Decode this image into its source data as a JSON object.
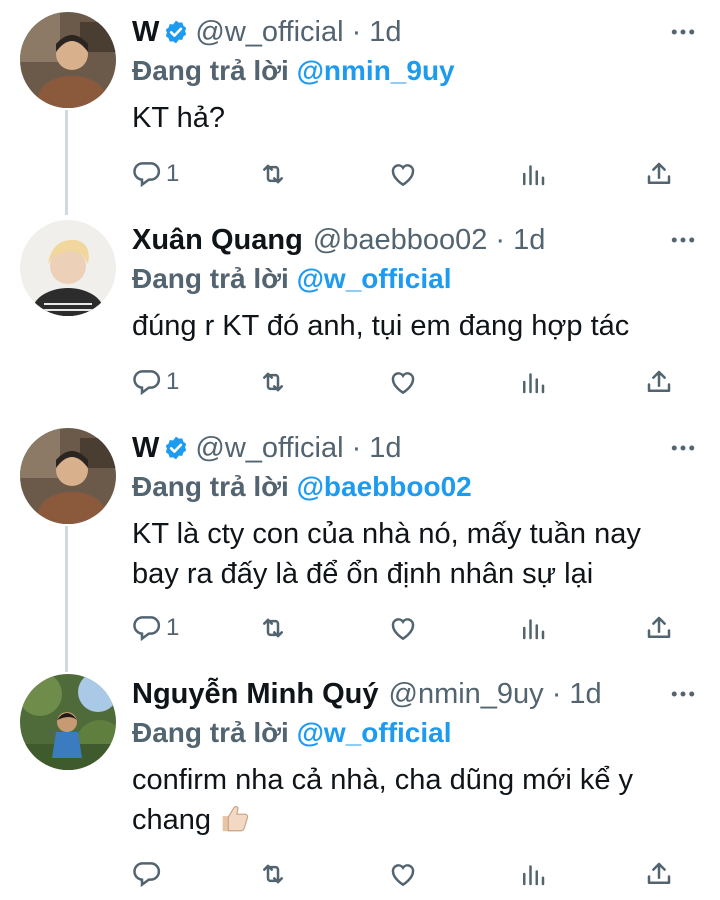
{
  "tweets": [
    {
      "name": "W",
      "verified": true,
      "handle": "@w_official",
      "dot": "·",
      "time": "1d",
      "replying_prefix": "Đang trả lời",
      "replying_to": "@nmin_9uy",
      "lines": [
        "KT hả?"
      ],
      "reply_count": "1",
      "avatar_colors": {
        "bg": "#6b5a4a",
        "skin": "#d9b08c",
        "hair": "#2b2420",
        "cloth": "#8b5a3c"
      }
    },
    {
      "name": "Xuân Quang",
      "verified": false,
      "handle": "@baebboo02",
      "dot": "·",
      "time": "1d",
      "replying_prefix": "Đang trả lời",
      "replying_to": "@w_official",
      "lines": [
        "đúng r KT đó anh, tụi em đang hợp tác"
      ],
      "reply_count": "1",
      "avatar_colors": {
        "bg": "#f1efec",
        "skin": "#ecd0b8",
        "hair": "#f2d79c",
        "cloth": "#2c2c2c"
      }
    },
    {
      "name": "W",
      "verified": true,
      "handle": "@w_official",
      "dot": "·",
      "time": "1d",
      "replying_prefix": "Đang trả lời",
      "replying_to": "@baebboo02",
      "lines": [
        "KT là cty con của nhà nó, mấy tuần nay",
        "bay ra đấy là để ổn định nhân sự lại"
      ],
      "reply_count": "1",
      "avatar_colors": {
        "bg": "#6b5a4a",
        "skin": "#d9b08c",
        "hair": "#2b2420",
        "cloth": "#8b5a3c"
      }
    },
    {
      "name": "Nguyễn Minh Quý",
      "verified": false,
      "handle": "@nmin_9uy",
      "dot": "·",
      "time": "1d",
      "replying_prefix": "Đang trả lời",
      "replying_to": "@w_official",
      "lines": [
        "confirm nha cả nhà, cha dũng mới kể y",
        "chang"
      ],
      "reply_count": "",
      "avatar_colors": {
        "bg": "#4f6b3a",
        "skin": "#c89a74",
        "hair": "#1f1a16",
        "cloth": "#3b7bbf"
      }
    }
  ],
  "colors": {
    "accent": "#1d9bf0",
    "muted": "#536471",
    "text": "#0f1419",
    "thread": "#cfd9de"
  },
  "icons": [
    "verified-badge-icon",
    "more-icon",
    "reply-icon",
    "retweet-icon",
    "like-icon",
    "analytics-icon",
    "share-icon",
    "thumbs-up-emoji"
  ]
}
